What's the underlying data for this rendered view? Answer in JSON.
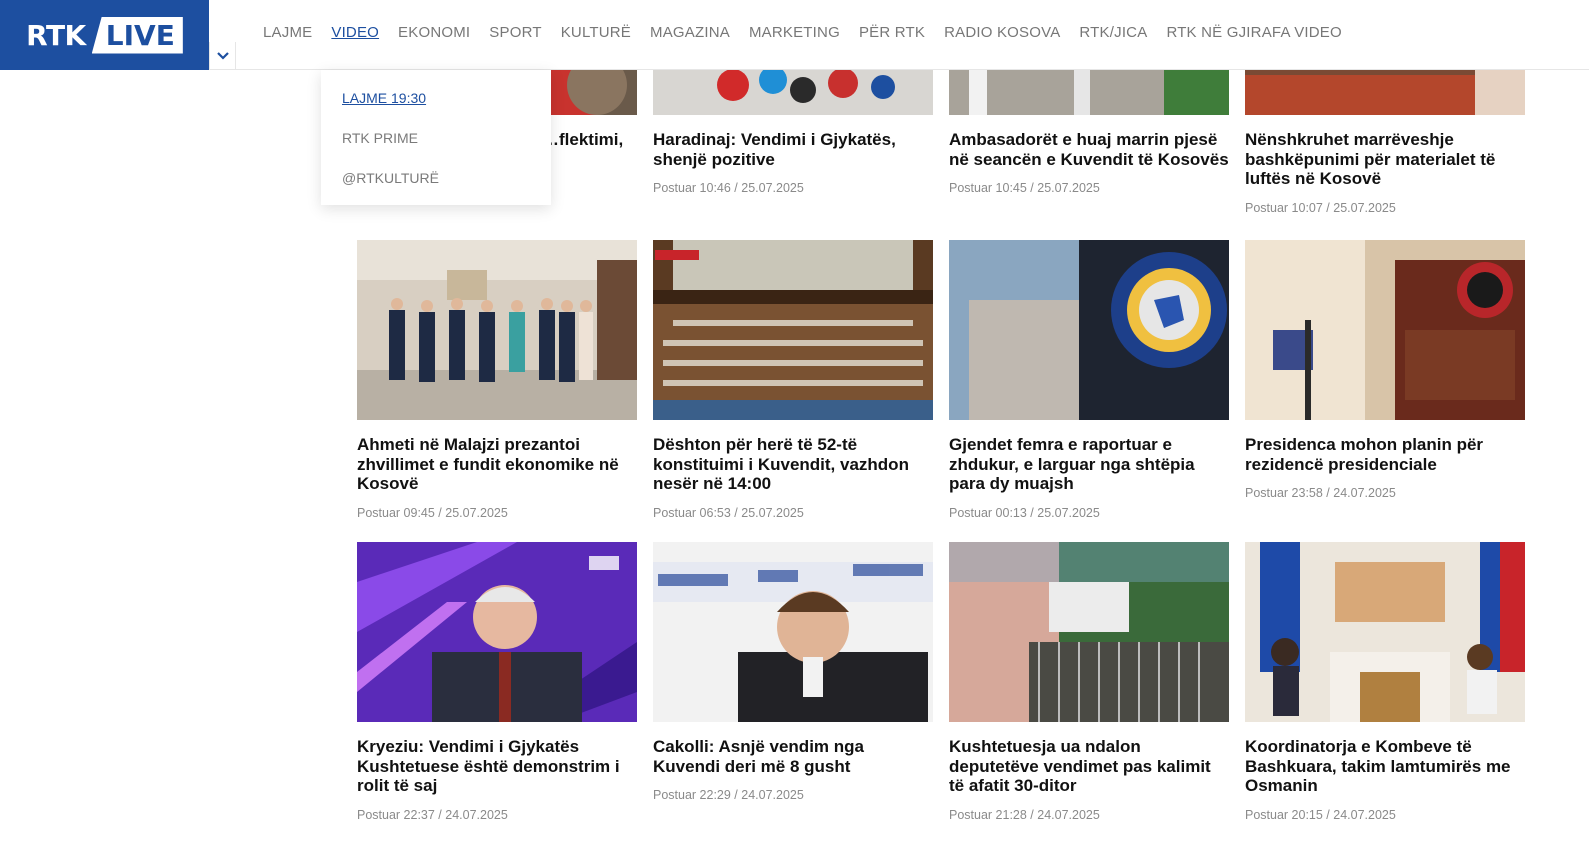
{
  "header": {
    "logo_left": "RTK",
    "logo_right": "LIVE",
    "nav": [
      "LAJME",
      "VIDEO",
      "EKONOMI",
      "SPORT",
      "KULTURË",
      "MAGAZINA",
      "MARKETING",
      "PËR RTK",
      "RADIO KOSOVA",
      "RTK/JICA",
      "RTK NË GJIRAFA VIDEO"
    ],
    "active_nav": "VIDEO",
    "toggle_icon": "chevron-down-icon"
  },
  "dropdown": {
    "items": [
      "LAJME 19:30",
      "RTK PRIME",
      "@RTKULTURË"
    ]
  },
  "row0": [
    {
      "title": "…flektimi,",
      "meta": ""
    },
    {
      "title": "Haradinaj: Vendimi i Gjykatës, shenjë pozitive",
      "meta": "Postuar 10:46 / 25.07.2025"
    },
    {
      "title": "Ambasadorët e huaj marrin pjesë në seancën e Kuvendit të Kosovës",
      "meta": "Postuar 10:45 / 25.07.2025"
    },
    {
      "title": "Nënshkruhet marrëveshje bashkëpunimi për materialet të luftës në Kosovë",
      "meta": "Postuar 10:07 / 25.07.2025"
    }
  ],
  "row1": [
    {
      "title": "Ahmeti në Malajzi prezantoi zhvillimet e fundit ekonomike në Kosovë",
      "meta": "Postuar 09:45 / 25.07.2025"
    },
    {
      "title": "Dështon për herë të 52-të konstituimi i Kuvendit, vazhdon nesër në 14:00",
      "meta": "Postuar 06:53 / 25.07.2025"
    },
    {
      "title": "Gjendet femra e raportuar e zhdukur, e larguar nga shtëpia para dy muajsh",
      "meta": "Postuar 00:13 / 25.07.2025"
    },
    {
      "title": "Presidenca mohon planin për rezidencë presidenciale",
      "meta": "Postuar 23:58 / 24.07.2025"
    }
  ],
  "row2": [
    {
      "title": "Kryeziu: Vendimi i Gjykatës Kushtetuese është demonstrim i rolit të saj",
      "meta": "Postuar 22:37 / 24.07.2025"
    },
    {
      "title": "Cakolli: Asnjë vendim nga Kuvendi deri më 8 gusht",
      "meta": "Postuar 22:29 / 24.07.2025"
    },
    {
      "title": "Kushtetuesja ua ndalon deputetëve vendimet pas kalimit të afatit 30-ditor",
      "meta": "Postuar 21:28 / 24.07.2025"
    },
    {
      "title": "Koordinatorja e Kombeve të Bashkuara, takim lamtumirës me Osmanin",
      "meta": "Postuar 20:15 / 24.07.2025"
    }
  ],
  "colors": {
    "brand": "#1d4fa0",
    "nav_text": "#777777",
    "meta_text": "#8a8a8a"
  }
}
